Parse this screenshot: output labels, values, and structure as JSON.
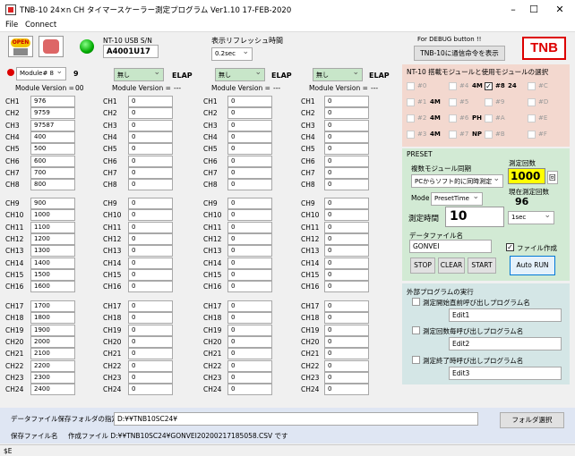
{
  "window": {
    "title": "TNB-10 24×n CH タイマースケーラー測定プログラム   Ver1.10  17-FEB-2020",
    "min_icon": "minimize-icon",
    "max_icon": "maximize-icon",
    "close_icon": "close-icon"
  },
  "menu": [
    "File",
    "Connect"
  ],
  "toolbar": {
    "open_label": "OPEN",
    "nt10_sn_label": "NT-10 USB S/N",
    "nt10_sn_value": "A4001U17",
    "refresh_label": "表示リフレッシュ時間",
    "refresh_value": "0.2sec",
    "debug_label": "For DEBUG button !!",
    "debug_button": "TNB-10に通信命令を表示",
    "logo": "TNB"
  },
  "modules": [
    {
      "select": "Module# 8",
      "num": "9",
      "version_label": "Module Version =",
      "version": "00",
      "channels": [
        [
          "976",
          "9759",
          "97587",
          "400",
          "500",
          "600",
          "700",
          "800"
        ],
        [
          "900",
          "1000",
          "1100",
          "1200",
          "1300",
          "1400",
          "1500",
          "1600"
        ],
        [
          "1700",
          "1800",
          "1900",
          "2000",
          "2100",
          "2200",
          "2300",
          "2400"
        ]
      ]
    },
    {
      "select": "無し",
      "elap": "ELAP",
      "version_label": "Module Version =",
      "version": "---",
      "channels": [
        [
          "0",
          "0",
          "0",
          "0",
          "0",
          "0",
          "0",
          "0"
        ],
        [
          "0",
          "0",
          "0",
          "0",
          "0",
          "0",
          "0",
          "0"
        ],
        [
          "0",
          "0",
          "0",
          "0",
          "0",
          "0",
          "0",
          "0"
        ]
      ]
    },
    {
      "select": "無し",
      "elap": "ELAP",
      "version_label": "Module Version =",
      "version": "---",
      "channels": [
        [
          "0",
          "0",
          "0",
          "0",
          "0",
          "0",
          "0",
          "0"
        ],
        [
          "0",
          "0",
          "0",
          "0",
          "0",
          "0",
          "0",
          "0"
        ],
        [
          "0",
          "0",
          "0",
          "0",
          "0",
          "0",
          "0",
          "0"
        ]
      ]
    },
    {
      "select": "無し",
      "elap": "ELAP",
      "version_label": "Module Version =",
      "version": "---",
      "channels": [
        [
          "0",
          "0",
          "0",
          "0",
          "0",
          "0",
          "0",
          "0"
        ],
        [
          "0",
          "0",
          "0",
          "0",
          "0",
          "0",
          "0",
          "0"
        ],
        [
          "0",
          "0",
          "0",
          "0",
          "0",
          "0",
          "0",
          "0"
        ]
      ]
    }
  ],
  "module_select": {
    "title": "NT-10 搭載モジュールと使用モジュールの選択",
    "rows": [
      [
        {
          "id": "#0",
          "tag": "",
          "on": false
        },
        {
          "id": "#4",
          "tag": "4M",
          "on": false
        },
        {
          "id": "#8",
          "tag": "24",
          "on": true,
          "checked": true
        },
        {
          "id": "#C",
          "tag": "",
          "on": false
        }
      ],
      [
        {
          "id": "#1",
          "tag": "4M",
          "on": false
        },
        {
          "id": "#5",
          "tag": "",
          "on": false
        },
        {
          "id": "#9",
          "tag": "",
          "on": false
        },
        {
          "id": "#D",
          "tag": "",
          "on": false
        }
      ],
      [
        {
          "id": "#2",
          "tag": "4M",
          "on": false
        },
        {
          "id": "#6",
          "tag": "PH",
          "on": false
        },
        {
          "id": "#A",
          "tag": "",
          "on": false
        },
        {
          "id": "#E",
          "tag": "",
          "on": false
        }
      ],
      [
        {
          "id": "#3",
          "tag": "4M",
          "on": false
        },
        {
          "id": "#7",
          "tag": "NP",
          "on": false
        },
        {
          "id": "#B",
          "tag": "",
          "on": false
        },
        {
          "id": "#F",
          "tag": "",
          "on": false
        }
      ]
    ]
  },
  "preset": {
    "title": "PRESET",
    "sync_label": "複数モジュール同期",
    "sync_value": "PCからソフト的に同時測定",
    "count_label": "測定回数",
    "count_value": "1000",
    "count_unit": "回",
    "current_count_label": "現在測定回数",
    "current_count_value": "96",
    "mode_label": "Mode",
    "mode_value": "PresetTime",
    "time_label": "測定時間",
    "time_value": "10",
    "time_unit": "1sec",
    "file_label": "データファイル名",
    "file_value": "GONVEI",
    "file_create_label": "ファイル作成",
    "stop": "STOP",
    "clear": "CLEAR",
    "start": "START",
    "autorun": "Auto RUN"
  },
  "external": {
    "title": "外部プログラムの実行",
    "items": [
      {
        "label": "測定開始直前呼び出しプログラム名",
        "value": "Edit1"
      },
      {
        "label": "測定回数毎呼び出しプログラム名",
        "value": "Edit2"
      },
      {
        "label": "測定終了時呼び出しプログラム名",
        "value": "Edit3"
      }
    ]
  },
  "footer": {
    "folder_label": "データファイル保存フォルダの指定",
    "folder_value": "D:¥¥TNB10SC24¥",
    "folder_button": "フォルダ選択",
    "savefile_label": "保存ファイル名",
    "savefile_value": "作成ファイル D:¥¥TNB10SC24¥GONVEI20200217185058.CSV  です"
  },
  "status": "$E"
}
